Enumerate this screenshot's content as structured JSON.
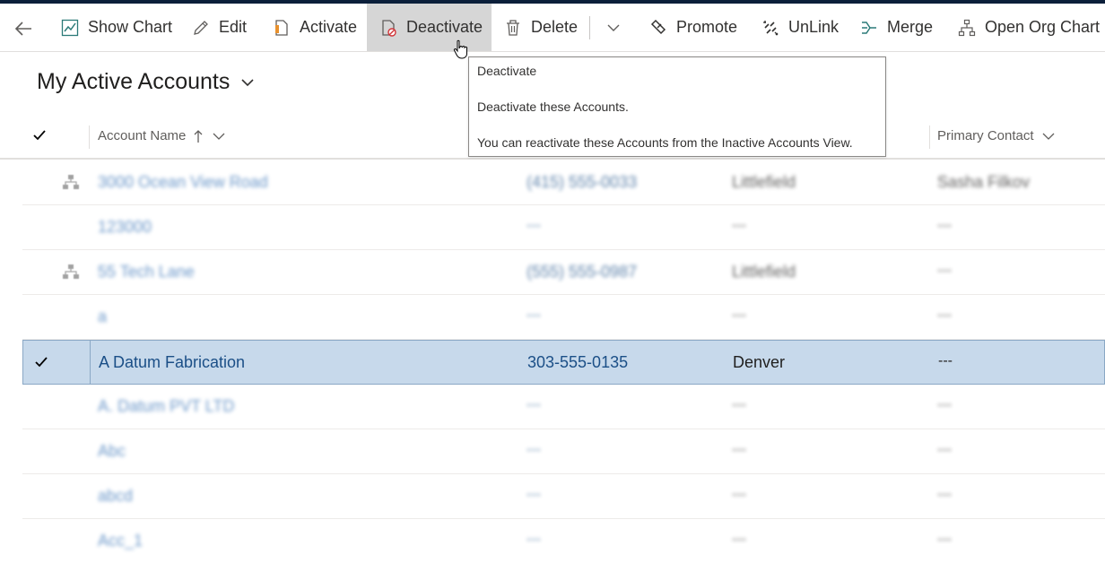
{
  "commandbar": {
    "back_label": "",
    "show_chart": "Show Chart",
    "edit": "Edit",
    "activate": "Activate",
    "deactivate": "Deactivate",
    "delete": "Delete",
    "promote": "Promote",
    "unlink": "UnLink",
    "merge": "Merge",
    "open_org_chart": "Open Org Chart"
  },
  "view": {
    "title": "My Active Accounts"
  },
  "tooltip": {
    "title": "Deactivate",
    "line1": "Deactivate these Accounts.",
    "line2": "You can reactivate these Accounts from the Inactive Accounts View."
  },
  "grid": {
    "headers": {
      "account_name": "Account Name",
      "primary_contact": "Primary Contact"
    },
    "rows": [
      {
        "name": "3000 Ocean View Road",
        "phone": "(415) 555-0033",
        "city": "Littlefield",
        "contact": "Sasha Filkov",
        "has_parent": true,
        "blurred": true
      },
      {
        "name": "123000",
        "phone": "---",
        "city": "---",
        "contact": "---",
        "has_parent": false,
        "blurred": true
      },
      {
        "name": "55 Tech Lane",
        "phone": "(555) 555-0987",
        "city": "Littlefield",
        "contact": "---",
        "has_parent": true,
        "blurred": true
      },
      {
        "name": "a",
        "phone": "---",
        "city": "---",
        "contact": "---",
        "has_parent": false,
        "blurred": true
      },
      {
        "name": "A Datum Fabrication",
        "phone": "303-555-0135",
        "city": "Denver",
        "contact": "---",
        "has_parent": false,
        "blurred": false,
        "selected": true
      },
      {
        "name": "A. Datum PVT LTD",
        "phone": "---",
        "city": "---",
        "contact": "---",
        "has_parent": false,
        "blurred": true
      },
      {
        "name": "Abc",
        "phone": "---",
        "city": "---",
        "contact": "---",
        "has_parent": false,
        "blurred": true
      },
      {
        "name": "abcd",
        "phone": "---",
        "city": "---",
        "contact": "---",
        "has_parent": false,
        "blurred": true
      },
      {
        "name": "Acc_1",
        "phone": "---",
        "city": "---",
        "contact": "---",
        "has_parent": false,
        "blurred": true
      }
    ]
  }
}
